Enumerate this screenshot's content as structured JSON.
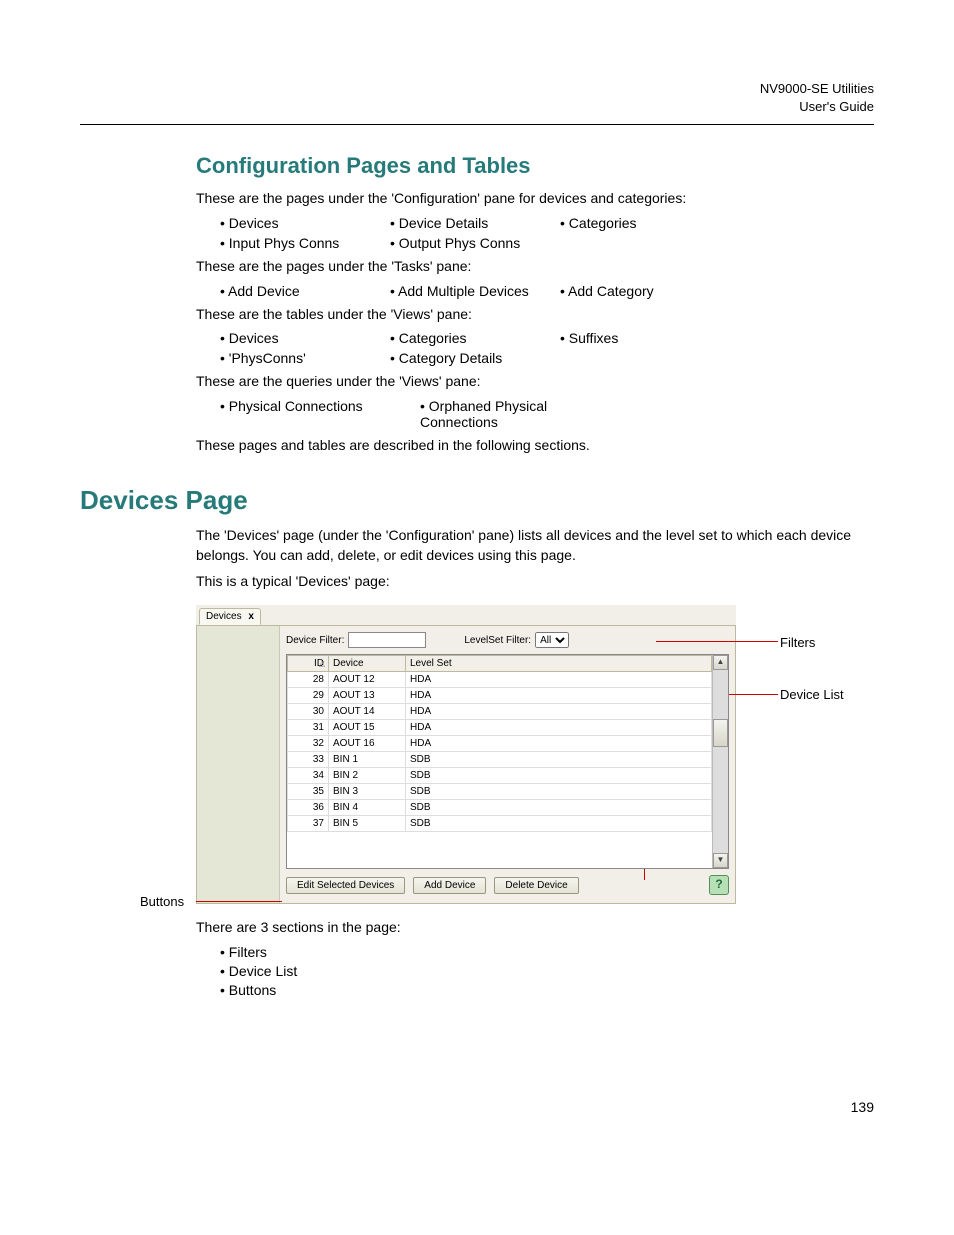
{
  "header": {
    "product": "NV9000-SE Utilities",
    "doc": "User's Guide"
  },
  "page_number": "139",
  "section1": {
    "title": "Configuration Pages and Tables",
    "p1": "These are the pages under the 'Configuration' pane for devices and categories:",
    "row1": [
      "Devices",
      "Device Details",
      "Categories"
    ],
    "row2": [
      "Input Phys Conns",
      "Output Phys Conns"
    ],
    "p2": "These are the pages under the 'Tasks' pane:",
    "row3": [
      "Add Device",
      "Add Multiple Devices",
      "Add Category"
    ],
    "p3": "These are the tables under the 'Views' pane:",
    "row4": [
      "Devices",
      "Categories",
      "Suffixes"
    ],
    "row5": [
      "'PhysConns'",
      "Category Details"
    ],
    "p4": "These are the queries under the 'Views' pane:",
    "row6": [
      "Physical Connections",
      "Orphaned Physical Connections"
    ],
    "p5": "These pages and tables are described in the following sections."
  },
  "section2": {
    "title": "Devices Page",
    "p1": "The 'Devices' page (under the 'Configuration' pane) lists all devices and the level set to which each device belongs. You can add, delete, or edit devices using this page.",
    "p2": "This is a typical 'Devices' page:",
    "after": "There are 3 sections in the page:",
    "sections": [
      "Filters",
      "Device List",
      "Buttons"
    ]
  },
  "screenshot": {
    "tab": {
      "label": "Devices",
      "close": "x"
    },
    "filters": {
      "device_filter_label": "Device Filter:",
      "device_filter_value": "",
      "levelset_filter_label": "LevelSet Filter:",
      "levelset_selected": "All"
    },
    "columns": {
      "id": "ID",
      "device": "Device",
      "levelset": "Level Set"
    },
    "rows": [
      {
        "id": "28",
        "device": "AOUT 12",
        "levelset": "HDA"
      },
      {
        "id": "29",
        "device": "AOUT 13",
        "levelset": "HDA"
      },
      {
        "id": "30",
        "device": "AOUT 14",
        "levelset": "HDA"
      },
      {
        "id": "31",
        "device": "AOUT 15",
        "levelset": "HDA"
      },
      {
        "id": "32",
        "device": "AOUT 16",
        "levelset": "HDA"
      },
      {
        "id": "33",
        "device": "BIN  1",
        "levelset": "SDB"
      },
      {
        "id": "34",
        "device": "BIN  2",
        "levelset": "SDB"
      },
      {
        "id": "35",
        "device": "BIN  3",
        "levelset": "SDB"
      },
      {
        "id": "36",
        "device": "BIN  4",
        "levelset": "SDB"
      },
      {
        "id": "37",
        "device": "BIN  5",
        "levelset": "SDB"
      }
    ],
    "buttons": {
      "edit": "Edit Selected Devices",
      "add": "Add Device",
      "delete": "Delete Device"
    },
    "help": "?"
  },
  "callouts": {
    "filters": "Filters",
    "device_list": "Device List",
    "buttons": "Buttons"
  }
}
